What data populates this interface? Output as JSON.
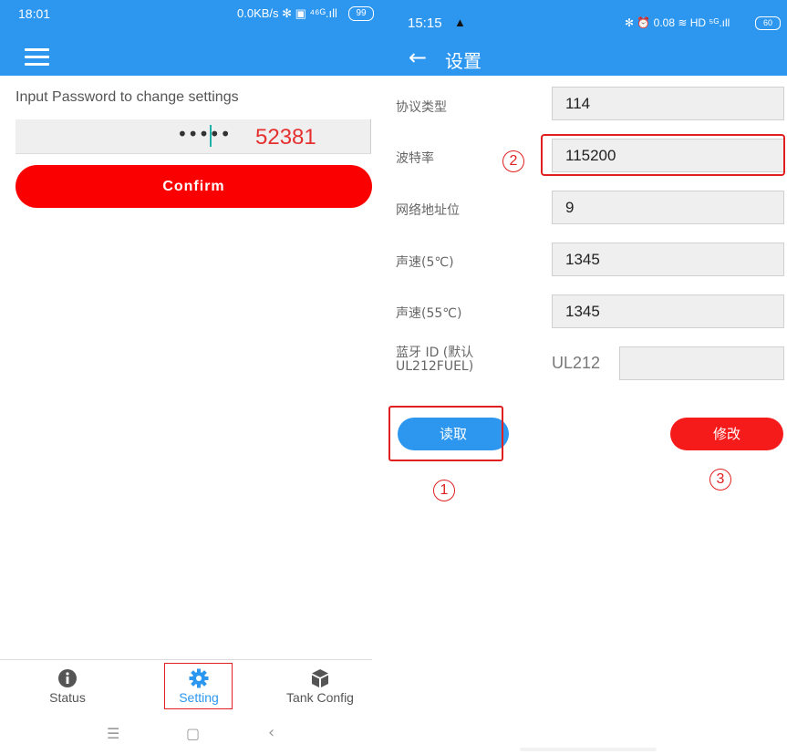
{
  "left": {
    "status": {
      "time": "18:01",
      "right": "0.0KB/s ✻ ▣ ⁴⁶ᴳ.ıll",
      "battery": "99"
    },
    "password_prompt": "Input Password to change settings",
    "password_mask": "•••••",
    "password_annotation": "52381",
    "confirm_label": "Confirm",
    "nav": [
      {
        "label": "Status",
        "icon": "info-icon"
      },
      {
        "label": "Setting",
        "icon": "gear-icon",
        "active": true
      },
      {
        "label": "Tank Config",
        "icon": "cube-icon"
      }
    ],
    "system_nav": {
      "menu": "☰",
      "home": "▢",
      "back": "‹"
    }
  },
  "right": {
    "status": {
      "time": "15:15",
      "alert": "▲",
      "right": "✻ ⏰ 0.08 ≋ HD ⁵ᴳ.ıll",
      "battery": "60"
    },
    "title": "设置",
    "fields": [
      {
        "label": "协议类型",
        "value": "114"
      },
      {
        "label": "波特率",
        "value": "115200"
      },
      {
        "label": "网络地址位",
        "value": "9"
      },
      {
        "label": "声速(5℃)",
        "value": "1345"
      },
      {
        "label": "声速(55℃)",
        "value": "1345"
      }
    ],
    "bluetooth": {
      "label_line1": "蓝牙 ID (默认",
      "label_line2": "UL212FUEL)",
      "prefix": "UL212",
      "value": ""
    },
    "read_label": "读取",
    "modify_label": "修改",
    "annotations": {
      "one": "1",
      "two": "2",
      "three": "3"
    }
  },
  "colors": {
    "appbar": "#2d97f0",
    "confirm": "#fb0000",
    "modify": "#f51b1b",
    "annotation": "#e02020"
  }
}
